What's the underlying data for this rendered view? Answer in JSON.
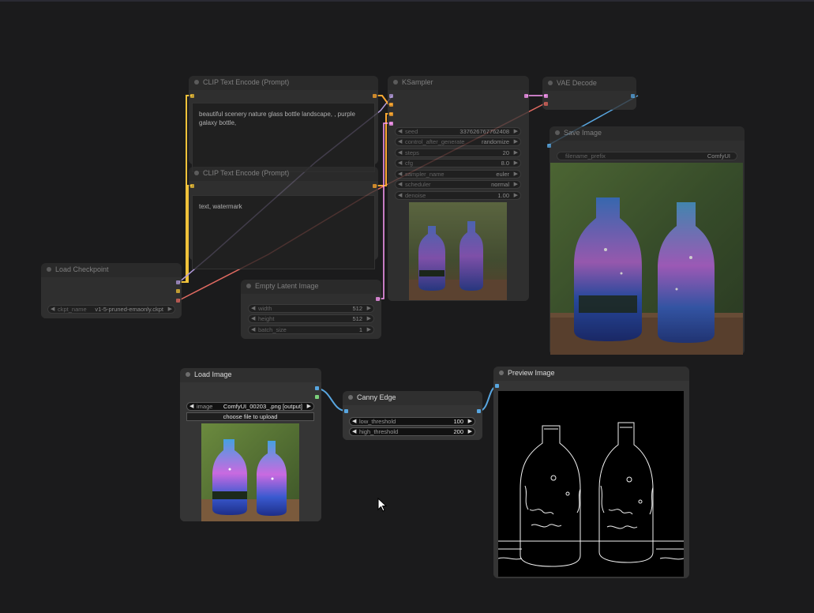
{
  "nodes": {
    "clip_text_pos": {
      "title": "CLIP Text Encode (Prompt)",
      "text": "beautiful scenery nature glass bottle landscape, , purple galaxy bottle,"
    },
    "clip_text_neg": {
      "title": "CLIP Text Encode (Prompt)",
      "text": "text, watermark"
    },
    "ksampler": {
      "title": "KSampler",
      "widgets": [
        {
          "name": "seed",
          "value": "337626767762408"
        },
        {
          "name": "control_after_generate",
          "value": "randomize"
        },
        {
          "name": "steps",
          "value": "20"
        },
        {
          "name": "cfg",
          "value": "8.0"
        },
        {
          "name": "sampler_name",
          "value": "euler"
        },
        {
          "name": "scheduler",
          "value": "normal"
        },
        {
          "name": "denoise",
          "value": "1.00"
        }
      ]
    },
    "vae_decode": {
      "title": "VAE Decode"
    },
    "save_image": {
      "title": "Save Image",
      "filename_prefix_label": "filename_prefix",
      "filename_prefix_value": "ComfyUI"
    },
    "load_checkpoint": {
      "title": "Load Checkpoint",
      "ckpt_label": "ckpt_name",
      "ckpt_value": "v1-5-pruned-emaonly.ckpt"
    },
    "empty_latent": {
      "title": "Empty Latent Image",
      "widgets": [
        {
          "name": "width",
          "value": "512"
        },
        {
          "name": "height",
          "value": "512"
        },
        {
          "name": "batch_size",
          "value": "1"
        }
      ]
    },
    "load_image": {
      "title": "Load Image",
      "image_label": "image",
      "image_value": "ComfyUI_00203_.png [output]",
      "upload_label": "choose file to upload"
    },
    "canny_edge": {
      "title": "Canny Edge",
      "widgets": [
        {
          "name": "low_threshold",
          "value": "100"
        },
        {
          "name": "high_threshold",
          "value": "200"
        }
      ]
    },
    "preview_image": {
      "title": "Preview Image"
    }
  },
  "colors": {
    "canvas_bg": "#1b1b1c",
    "node_bg": "#353535",
    "title_bg": "#2f2f2f",
    "clip_link": "#f0c23a",
    "model_link": "#b39bdb",
    "vae_link": "#e06a61",
    "latent_link": "#ff9cf9",
    "image_link": "#58a6e0",
    "conditioning_link": "#ffa931"
  },
  "icons": {
    "cursor": "mouse-pointer-icon"
  }
}
